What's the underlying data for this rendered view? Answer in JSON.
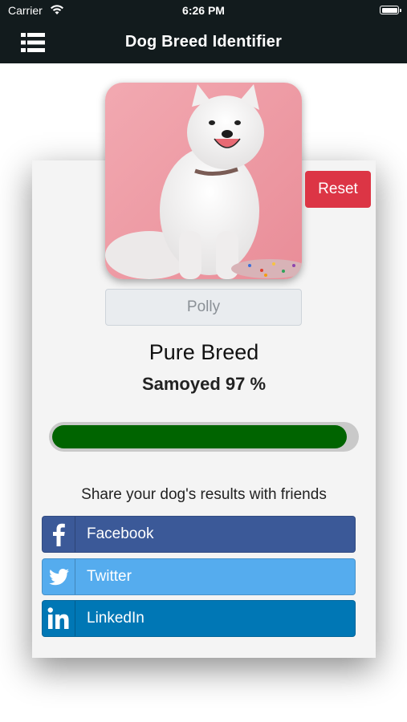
{
  "status_bar": {
    "carrier": "Carrier",
    "time": "6:26 PM"
  },
  "navbar": {
    "title": "Dog Breed Identifier",
    "menu_icon": "hamburger-menu-icon"
  },
  "reset_label": "Reset",
  "dog_name": "Polly",
  "result": {
    "type": "Pure Breed",
    "breed_confidence": "Samoyed 97 %",
    "confidence_percent": 97
  },
  "share": {
    "prompt": "Share your dog's results with friends",
    "buttons": [
      {
        "label": "Facebook",
        "icon": "facebook-icon",
        "color": "#3b5998"
      },
      {
        "label": "Twitter",
        "icon": "twitter-icon",
        "color": "#55acee"
      },
      {
        "label": "LinkedIn",
        "icon": "linkedin-icon",
        "color": "#0077b5"
      }
    ]
  },
  "colors": {
    "header_bg": "#121b1d",
    "reset_bg": "#dc3545",
    "progress_fill": "#006400",
    "card_bg": "#f4f4f4"
  }
}
